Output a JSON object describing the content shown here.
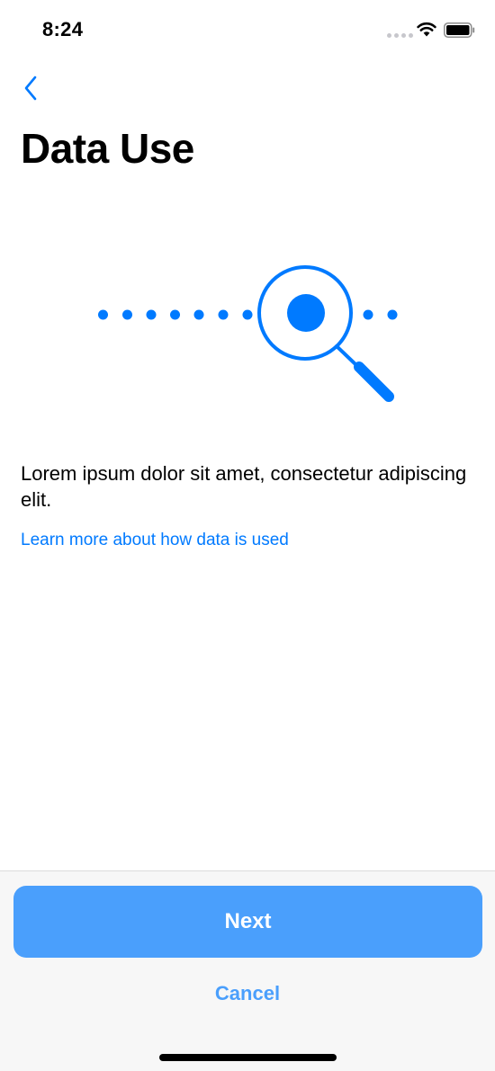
{
  "status_bar": {
    "time": "8:24",
    "icons": [
      "signal-dots-icon",
      "wifi-icon",
      "battery-icon"
    ]
  },
  "nav": {
    "back_icon": "chevron-left-icon"
  },
  "page": {
    "title": "Data Use",
    "illustration_icon": "magnifying-glass-icon",
    "description": "Lorem ipsum dolor sit amet, consectetur adipiscing elit.",
    "learn_more_link": "Learn more about how data is used"
  },
  "actions": {
    "next_label": "Next",
    "cancel_label": "Cancel"
  },
  "colors": {
    "accent": "#007aff",
    "button": "#4a9ffc",
    "panel": "#f7f7f7"
  }
}
